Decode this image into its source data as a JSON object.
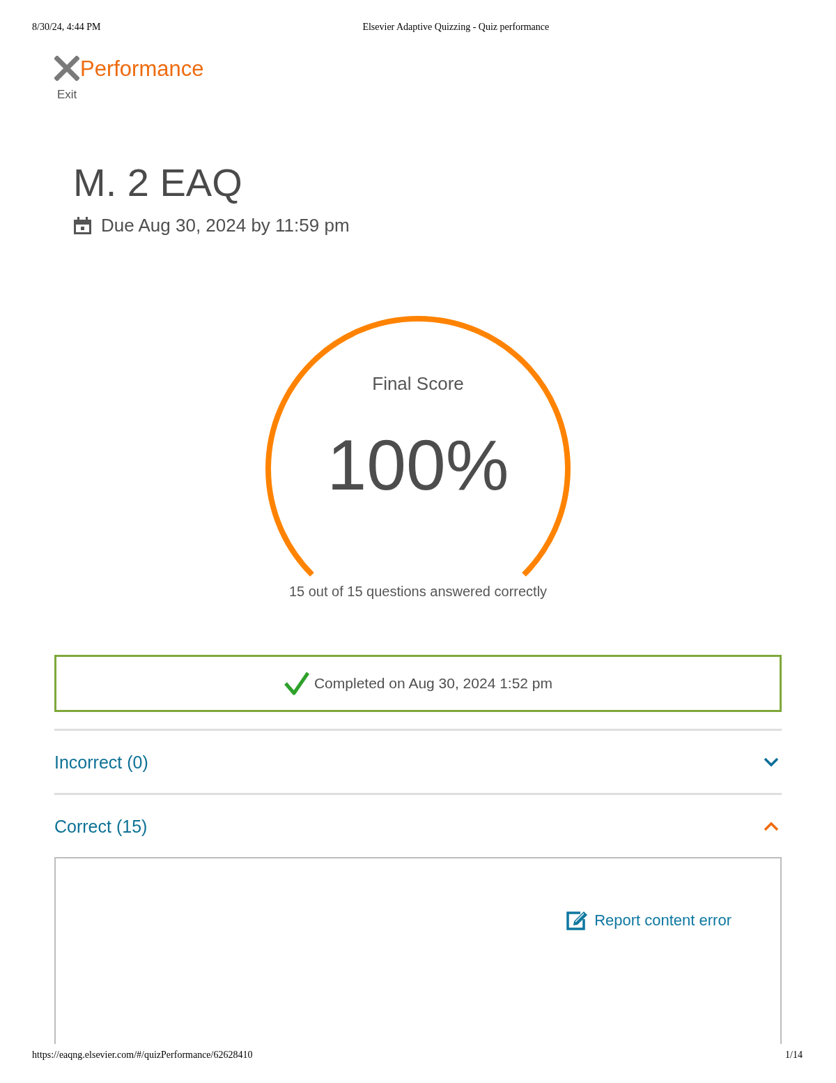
{
  "print_header": {
    "date": "8/30/24, 4:44 PM",
    "title": "Elsevier Adaptive Quizzing - Quiz performance"
  },
  "header": {
    "title": "Performance",
    "exit_label": "Exit"
  },
  "quiz": {
    "title": "M. 2 EAQ",
    "due": "Due Aug 30, 2024 by 11:59 pm"
  },
  "score": {
    "label": "Final Score",
    "value": "100%",
    "summary": "15 out of 15 questions answered correctly"
  },
  "completion": {
    "text": "Completed on Aug 30, 2024 1:52 pm"
  },
  "sections": [
    {
      "label": "Incorrect (0)",
      "expanded": false
    },
    {
      "label": "Correct (15)",
      "expanded": true,
      "report_link": "Report content error"
    }
  ],
  "print_footer": {
    "url": "https://eaqng.elsevier.com/#/quizPerformance/62628410",
    "page": "1/14"
  }
}
